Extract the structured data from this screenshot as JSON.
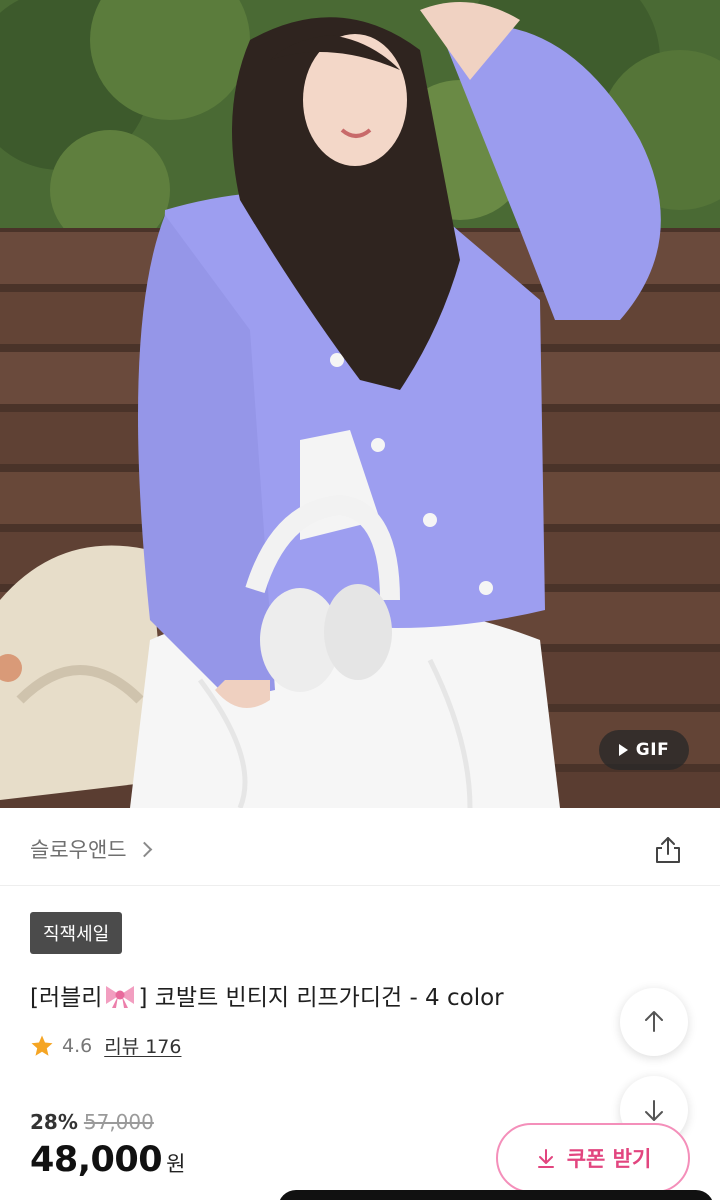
{
  "hero": {
    "gif_label": "GIF",
    "colors": {
      "cardigan": "#9d9ef0",
      "skirt": "#fafafa",
      "bench": "#5c3f33",
      "foliage": "#3d5a2c"
    }
  },
  "brand": {
    "name": "슬로우앤드"
  },
  "product": {
    "badge": "직잭세일",
    "title_prefix": "[러블리",
    "title_suffix": "] 코발트 빈티지 리프가디건 - 4 color",
    "rating": "4.6",
    "review_label": "리뷰 176",
    "discount": "28%",
    "original_price": "57,000",
    "price": "48,000",
    "currency": "원"
  },
  "actions": {
    "coupon_label": "쿠폰 받기"
  },
  "icons": {
    "share": "share-icon",
    "scroll_up": "arrow-up-icon",
    "scroll_down": "arrow-down-icon",
    "download": "download-icon",
    "star": "star-icon",
    "bow": "ribbon-emoji",
    "play": "play-icon"
  },
  "colors": {
    "star": "#f5a524",
    "coupon_border": "#f48fba",
    "coupon_text": "#e2457f",
    "badge_bg": "#4b4b4b"
  }
}
